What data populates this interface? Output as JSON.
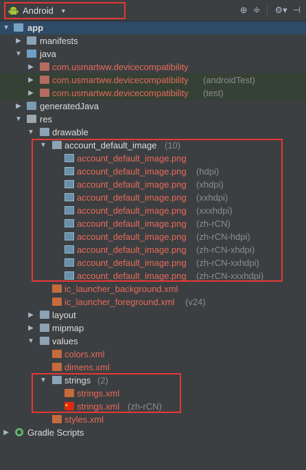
{
  "toolbar": {
    "view_label": "Android"
  },
  "tree": {
    "app": "app",
    "manifests": "manifests",
    "java": "java",
    "pkg1": "com.usmartww.devicecompatibility",
    "pkg2": "com.usmartww.devicecompatibility",
    "pkg2_suffix": "(androidTest)",
    "pkg3": "com.usmartww.devicecompatibility",
    "pkg3_suffix": "(test)",
    "generatedJava": "generatedJava",
    "res": "res",
    "drawable": "drawable",
    "account_folder": "account_default_image",
    "account_count": "(10)",
    "img_name": "account_default_image.png",
    "img_qualifiers": [
      "",
      "(hdpi)",
      "(xhdpi)",
      "(xxhdpi)",
      "(xxxhdpi)",
      "(zh-rCN)",
      "(zh-rCN-hdpi)",
      "(zh-rCN-xhdpi)",
      "(zh-rCN-xxhdpi)",
      "(zh-rCN-xxxhdpi)"
    ],
    "ic_bg": "ic_launcher_background.xml",
    "ic_fg": "ic_launcher_foreground.xml",
    "ic_fg_suffix": "(v24)",
    "layout": "layout",
    "mipmap": "mipmap",
    "values": "values",
    "colors": "colors.xml",
    "dimens": "dimens.xml",
    "strings_folder": "strings",
    "strings_count": "(2)",
    "strings_xml": "strings.xml",
    "strings_xml_zh": "strings.xml",
    "strings_zh_suffix": "(zh-rCN)",
    "styles": "styles.xml",
    "gradle": "Gradle Scripts"
  }
}
